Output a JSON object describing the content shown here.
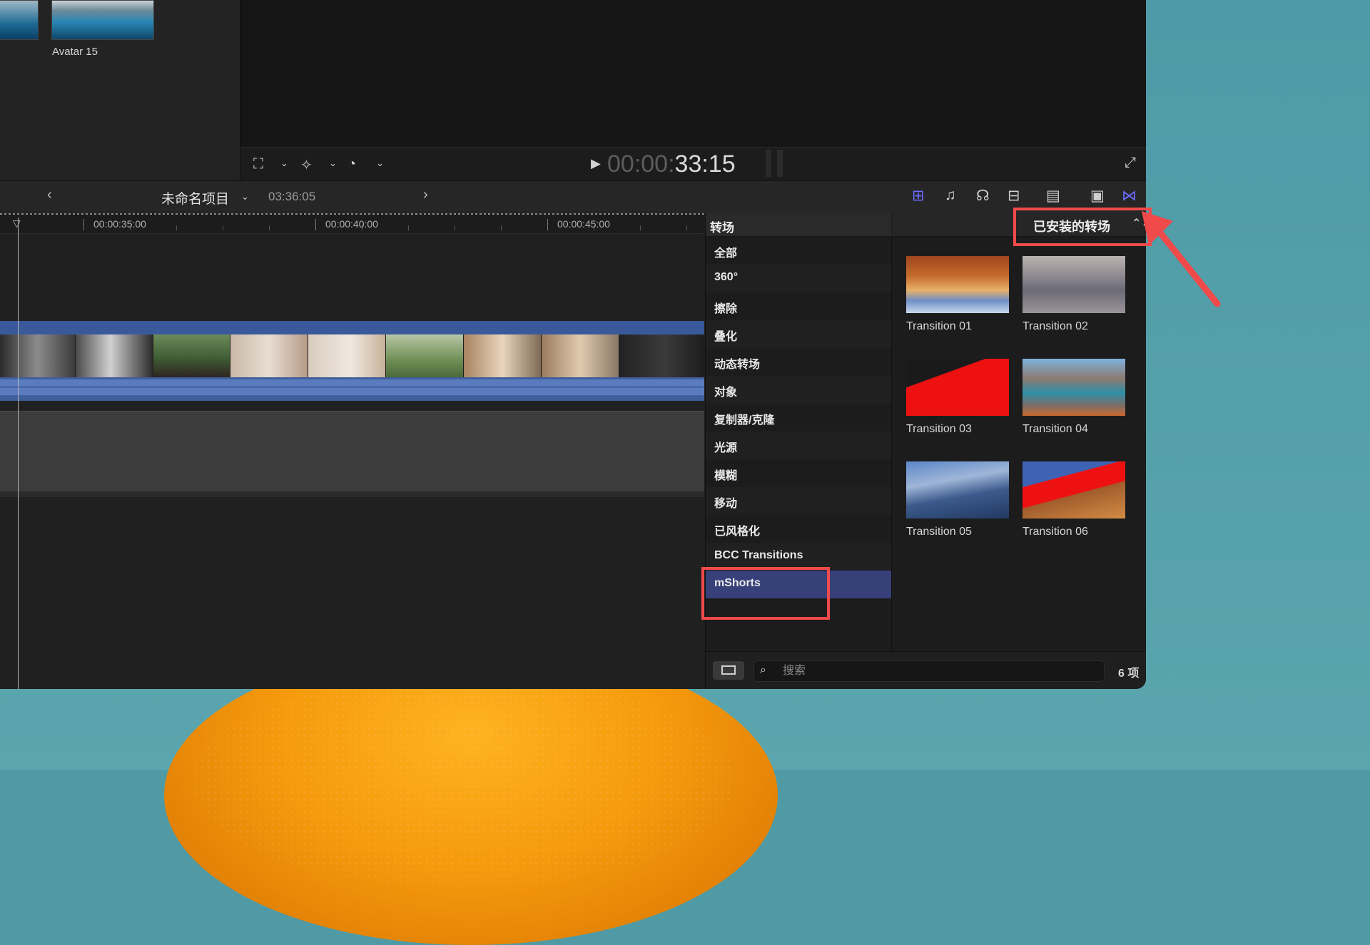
{
  "browser": {
    "clip_label": "Avatar 15"
  },
  "viewer": {
    "timecode_dim": "00:00:",
    "timecode_lit": "33:15"
  },
  "timeline_header": {
    "project_name": "未命名项目",
    "duration": "03:36:05"
  },
  "ruler": {
    "labels": [
      "00:00:35:00",
      "00:00:40:00",
      "00:00:45:00"
    ]
  },
  "transitions": {
    "header": "转场",
    "installed_label": "已安装的转场",
    "categories": [
      "全部",
      "360°",
      "擦除",
      "叠化",
      "动态转场",
      "对象",
      "复制器/克隆",
      "光源",
      "模糊",
      "移动",
      "已风格化",
      "BCC Transitions",
      "mShorts"
    ],
    "selected_category": "mShorts",
    "items": [
      "Transition 01",
      "Transition 02",
      "Transition 03",
      "Transition 04",
      "Transition 05",
      "Transition 06"
    ],
    "search_placeholder": "搜索",
    "count": "6 项"
  },
  "colors": {
    "accent": "#3e5f9c",
    "selection": "#38407a",
    "highlight": "#f04a4a"
  }
}
